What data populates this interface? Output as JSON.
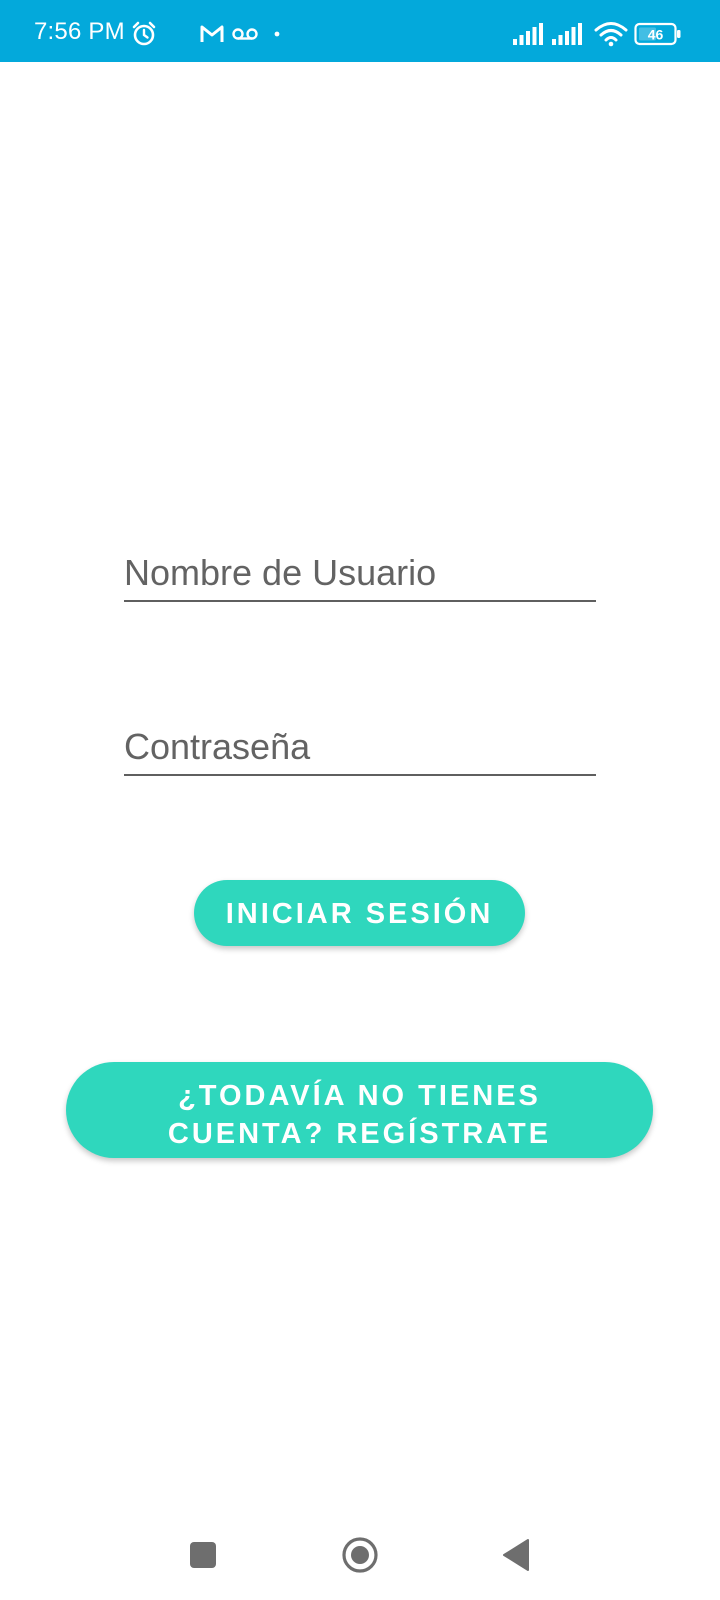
{
  "status_bar": {
    "time": "7:56 PM",
    "battery_level": "46",
    "color": "#03a9db",
    "icons": [
      "alarm-icon",
      "gmail-icon",
      "voicemail-icon",
      "notification-dot-icon",
      "signal-icon",
      "signal-icon",
      "wifi-icon",
      "battery-icon"
    ]
  },
  "login_form": {
    "username_placeholder": "Nombre de Usuario",
    "password_placeholder": "Contraseña",
    "login_button_label": "INICIAR SESIÓN",
    "register_button_label": "¿TODAVÍA NO TIENES CUENTA? REGÍSTRATE",
    "accent_color": "#2fd7bd"
  },
  "nav_bar": {
    "icons": [
      "recents-square-icon",
      "home-circle-icon",
      "back-triangle-icon"
    ]
  }
}
